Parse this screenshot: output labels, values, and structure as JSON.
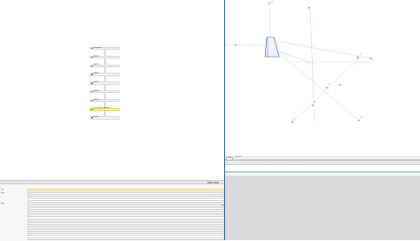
{
  "workflow": {
    "items": [
      {
        "label": "Perspective",
        "selected": false
      },
      {
        "label": "SETUP",
        "selected": false
      },
      {
        "label": "SETUP",
        "selected": false
      },
      {
        "label": "SETUP",
        "selected": false
      },
      {
        "label": "SETUP",
        "selected": false
      },
      {
        "label": "SETUP",
        "selected": false
      },
      {
        "label": "SETUP",
        "selected": false
      },
      {
        "label": "Fix and edit orientation",
        "selected": true
      },
      {
        "label": "Finish",
        "selected": false
      }
    ],
    "ellipsis": "..."
  },
  "properties": {
    "rows": [
      {
        "label": "Type",
        "value": "SETUP",
        "highlight": true,
        "button": false
      },
      {
        "label": "Name",
        "value": "Perspective Transformation",
        "highlight": false,
        "button": false
      },
      {
        "label": "",
        "value": "",
        "highlight": false,
        "button": false
      },
      {
        "label": "",
        "value": "Auto",
        "highlight": false,
        "button": false
      },
      {
        "label": "Mode",
        "value": "",
        "highlight": false,
        "button": true
      },
      {
        "label": "",
        "value": "SETUP",
        "highlight": false,
        "button": false
      },
      {
        "label": "",
        "value": "1.0",
        "highlight": false,
        "button": false
      },
      {
        "label": "",
        "value": "Fix and edit orientation",
        "highlight": false,
        "button": true
      },
      {
        "label": "",
        "value": "",
        "highlight": false,
        "button": false
      },
      {
        "label": "",
        "value": "",
        "highlight": false,
        "button": false
      },
      {
        "label": "",
        "value": "",
        "highlight": false,
        "button": false
      },
      {
        "label": "",
        "value": "",
        "highlight": false,
        "button": false
      },
      {
        "label": "",
        "value": "AOF data point",
        "highlight": false,
        "button": false
      },
      {
        "label": "",
        "value": "",
        "highlight": false,
        "button": false
      }
    ]
  },
  "viewport": {
    "tabs": [
      "Points",
      "Orientation"
    ],
    "labels": [
      {
        "text": "CP",
        "key": "top"
      },
      {
        "text": "P1",
        "key": "p1"
      },
      {
        "text": "P2",
        "key": "p2"
      },
      {
        "text": "P3",
        "key": "p3"
      },
      {
        "text": "P4",
        "key": "p4"
      },
      {
        "text": "P5",
        "key": "p5"
      }
    ]
  },
  "table": {
    "headers": [
      "Name",
      "X",
      "Y",
      "Quality Type",
      "Orientation",
      "Quality Ref."
    ],
    "rows": [
      {
        "cells": [
          "Point 1",
          "1024",
          "34",
          "ok",
          "Orientation Fixed",
          "ok"
        ],
        "selected": false
      },
      {
        "cells": [
          "Point 2",
          "1002",
          "55",
          "ok",
          "Orientation Fixed",
          "ok"
        ],
        "selected": false
      },
      {
        "cells": [
          "Point 3",
          "1003",
          "56",
          "ok",
          "Orientation Fixed",
          "ok"
        ],
        "selected": false
      },
      {
        "cells": [
          "Point 4",
          "1001",
          "57",
          "ok",
          "Orientation Fixed",
          "ok"
        ],
        "selected": true
      }
    ]
  },
  "colors": {
    "accent": "#2a5fae",
    "selection": "#9fd9dc",
    "highlight_item": "#fff6c6"
  }
}
